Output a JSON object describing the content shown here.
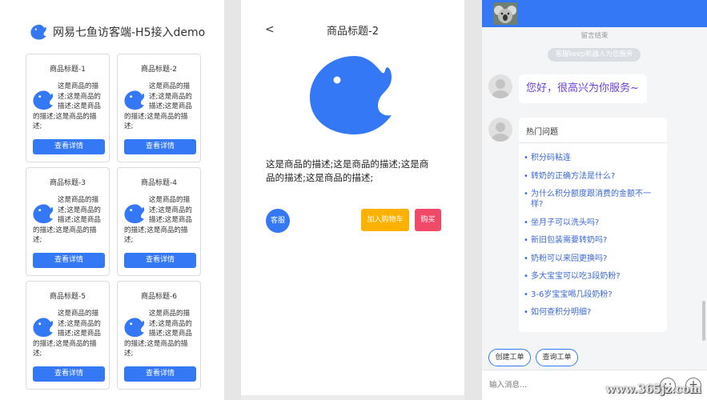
{
  "list_page": {
    "title": "网易七鱼访客端-H5接入demo",
    "cards": [
      {
        "title": "商品标题-1",
        "desc": "这是商品的描述;这是商品的描述;这是商品的描述;这是商品的描述;",
        "button": "查看详情"
      },
      {
        "title": "商品标题-2",
        "desc": "这是商品的描述;这是商品的描述;这是商品的描述;这是商品的描述;",
        "button": "查看详情"
      },
      {
        "title": "商品标题-3",
        "desc": "这是商品的描述;这是商品的描述;这是商品的描述;这是商品的描述;",
        "button": "查看详情"
      },
      {
        "title": "商品标题-4",
        "desc": "这是商品的描述;这是商品的描述;这是商品的描述;这是商品的描述;",
        "button": "查看详情"
      },
      {
        "title": "商品标题-5",
        "desc": "这是商品的描述;这是商品的描述;这是商品的描述;这是商品的描述;",
        "button": "查看详情"
      },
      {
        "title": "商品标题-6",
        "desc": "这是商品的描述;这是商品的描述;这是商品的描述;这是商品的描述;",
        "button": "查看详情"
      }
    ]
  },
  "detail_page": {
    "back": "<",
    "title": "商品标题-2",
    "desc": "这是商品的描述;这是商品的描述;这是商品的描述;这是商品的描述;",
    "service_button": "客服",
    "cart_button": "加入购物车",
    "buy_button": "购买"
  },
  "chat_page": {
    "notice": "留言结束",
    "system_pill": "客服keep机器人为您服务",
    "greeting": "您好，很高兴为你服务~",
    "hot_title": "热门问题",
    "questions": [
      "积分码粘连",
      "转奶的正确方法是什么?",
      "为什么积分额度跟消费的金额不一样?",
      "坐月子可以洗头吗?",
      "新旧包装需要转奶吗?",
      "奶粉可以来回更换吗?",
      "多大宝宝可以吃3段奶粉?",
      "3-6岁宝宝喝几段奶粉?",
      "如何查积分明细?"
    ],
    "create_ticket": "创建工单",
    "query_ticket": "查询工单",
    "input_placeholder": "输入消息..."
  },
  "watermark": "www.365jz.com",
  "colors": {
    "brand_blue": "#3478f6",
    "cart_orange": "#ffb100",
    "buy_red": "#f14a68",
    "link_blue": "#3a68d0",
    "greeting_purple": "#6a3fd6"
  }
}
